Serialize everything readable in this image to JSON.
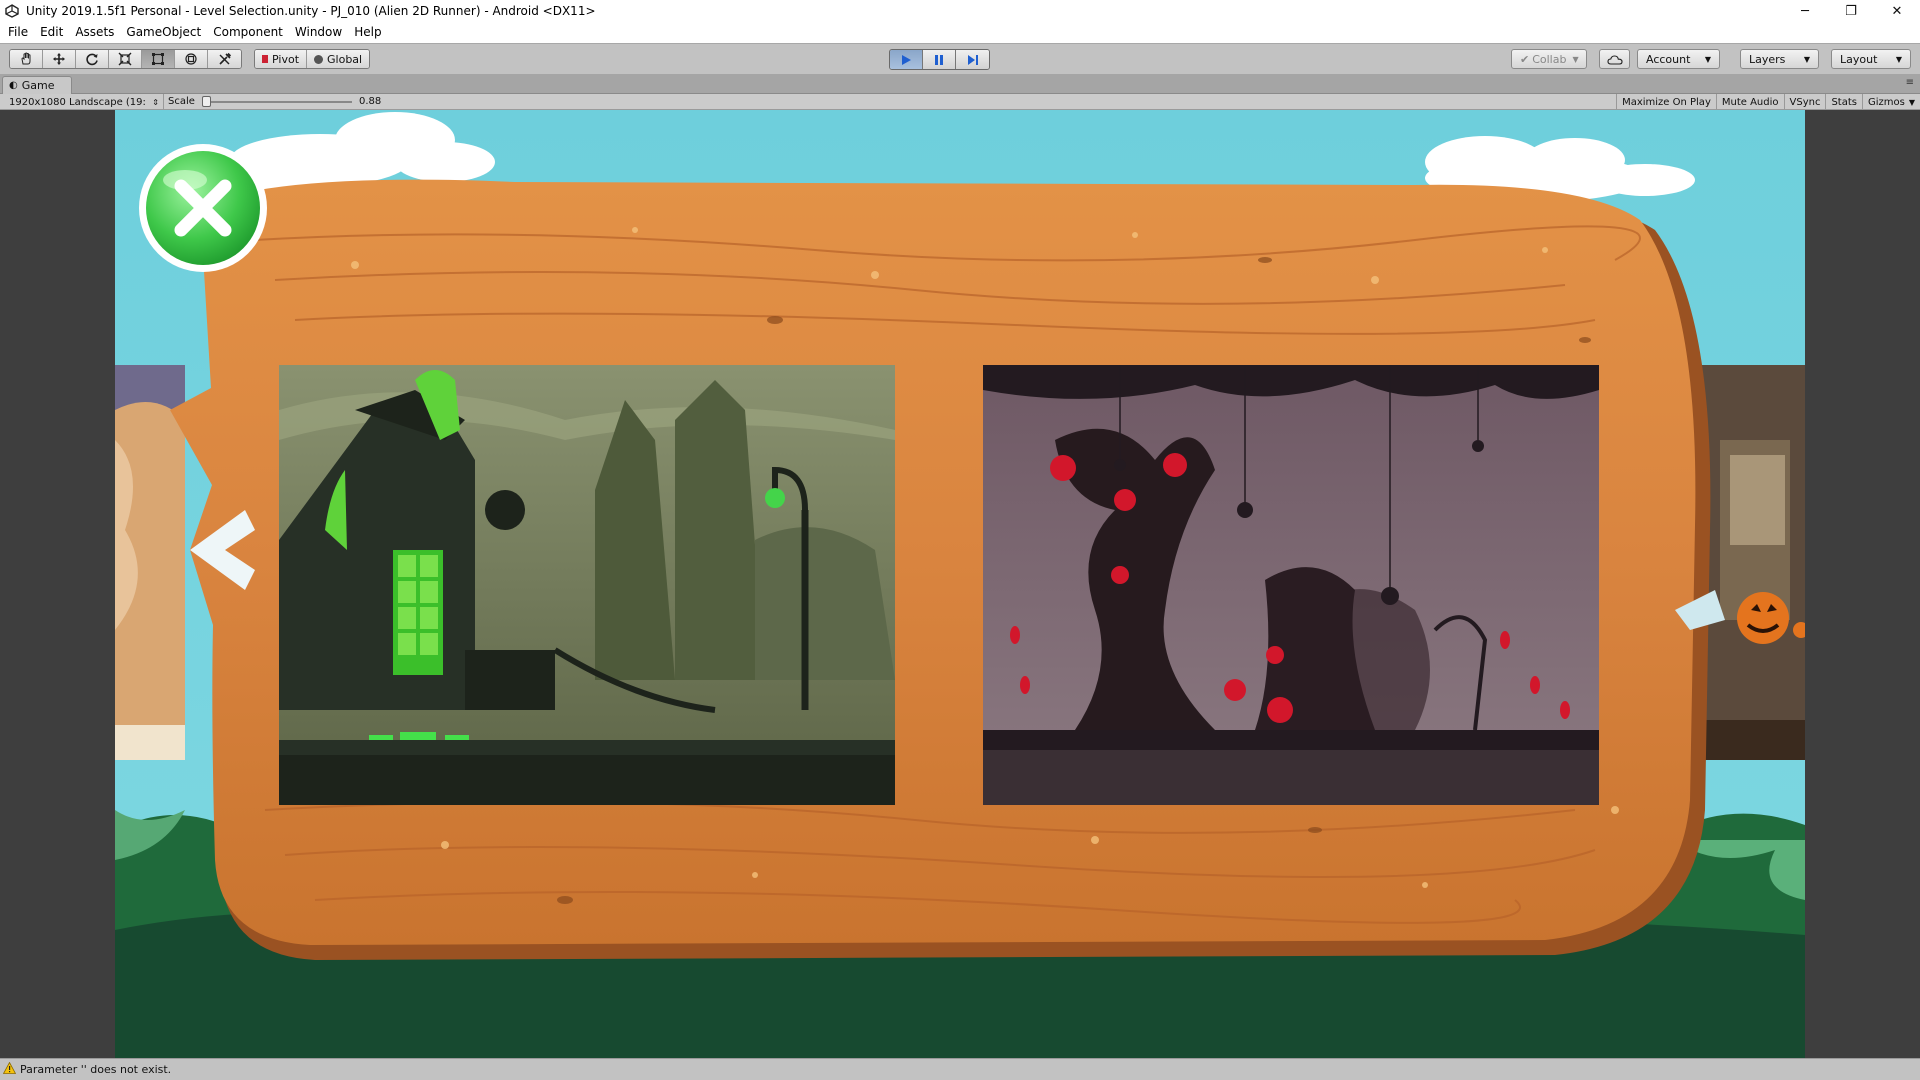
{
  "window": {
    "title": "Unity 2019.1.5f1 Personal - Level Selection.unity - PJ_010 (Alien 2D Runner) - Android <DX11>",
    "controls": [
      "─",
      "❐",
      "✕"
    ]
  },
  "menu": [
    "File",
    "Edit",
    "Assets",
    "GameObject",
    "Component",
    "Window",
    "Help"
  ],
  "toolbar": {
    "transform_tools": [
      "hand-tool-icon",
      "move-tool-icon",
      "rotate-tool-icon",
      "scale-tool-icon",
      "rect-tool-icon",
      "transform-tool-icon",
      "custom-tool-icon"
    ],
    "pivot_label": "Pivot",
    "global_label": "Global",
    "collab_label": "Collab",
    "account_label": "Account",
    "layers_label": "Layers",
    "layout_label": "Layout"
  },
  "game_tab": {
    "label": "Game"
  },
  "game_toolbar": {
    "resolution": "1920x1080 Landscape (19:",
    "scale_label": "Scale",
    "scale_value": "0.88",
    "scale_fraction": 0.0,
    "buttons": [
      "Maximize On Play",
      "Mute Audio",
      "VSync",
      "Stats"
    ],
    "gizmos_label": "Gizmos"
  },
  "status": {
    "message": "Parameter '' does not exist."
  },
  "colors": {
    "sky": "#6ecfdc",
    "wood": "#d9843f",
    "wood_dark": "#b8632a",
    "close_button": "#3fc84a",
    "ground": "#2f7a4c",
    "play_active": "#8aa6c9"
  },
  "scene": {
    "close_button_icon": "close-icon",
    "levels": [
      "haunted-house-level-thumbnail",
      "spooky-forest-level-thumbnail"
    ]
  }
}
